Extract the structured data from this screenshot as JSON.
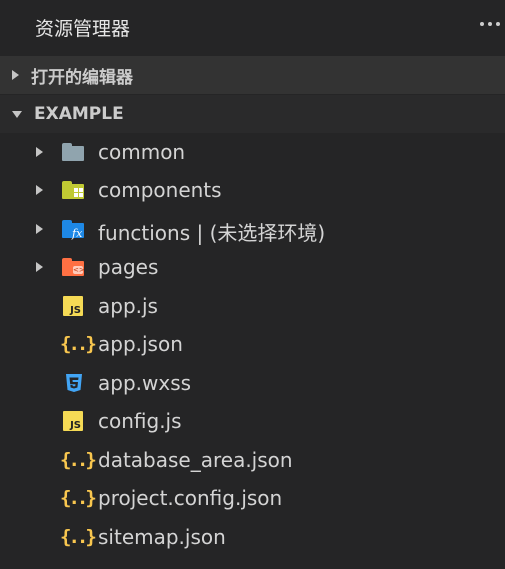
{
  "panel": {
    "title": "资源管理器"
  },
  "sections": {
    "open_editors": "打开的编辑器",
    "workspace": "EXAMPLE"
  },
  "colors": {
    "background": "#252526",
    "section_header_bg": "#333333",
    "text": "#d4d4d4",
    "folder_gray": "#90a4ae",
    "folder_green": "#c0ca33",
    "folder_blue": "#1e88e5",
    "folder_orange": "#ff7043",
    "js_yellow": "#f5da55",
    "json_yellow": "#f9c74f",
    "css_blue": "#42a5f5"
  },
  "tree": [
    {
      "label": "common",
      "icon": "folder-icon",
      "expandable": true
    },
    {
      "label": "components",
      "icon": "components-folder-icon",
      "expandable": true
    },
    {
      "label": "functions | (未选择环境)",
      "icon": "functions-folder-icon",
      "expandable": true
    },
    {
      "label": "pages",
      "icon": "pages-folder-icon",
      "expandable": true
    },
    {
      "label": "app.js",
      "icon": "js-file-icon",
      "expandable": false
    },
    {
      "label": "app.json",
      "icon": "json-file-icon",
      "expandable": false
    },
    {
      "label": "app.wxss",
      "icon": "css-file-icon",
      "expandable": false
    },
    {
      "label": "config.js",
      "icon": "js-file-icon",
      "expandable": false
    },
    {
      "label": "database_area.json",
      "icon": "json-file-icon",
      "expandable": false
    },
    {
      "label": "project.config.json",
      "icon": "json-file-icon",
      "expandable": false
    },
    {
      "label": "sitemap.json",
      "icon": "json-file-icon",
      "expandable": false
    }
  ],
  "icons": {
    "js_text": "JS",
    "json_text": "{..}",
    "fx_text": "fx",
    "code_text": "<>"
  }
}
